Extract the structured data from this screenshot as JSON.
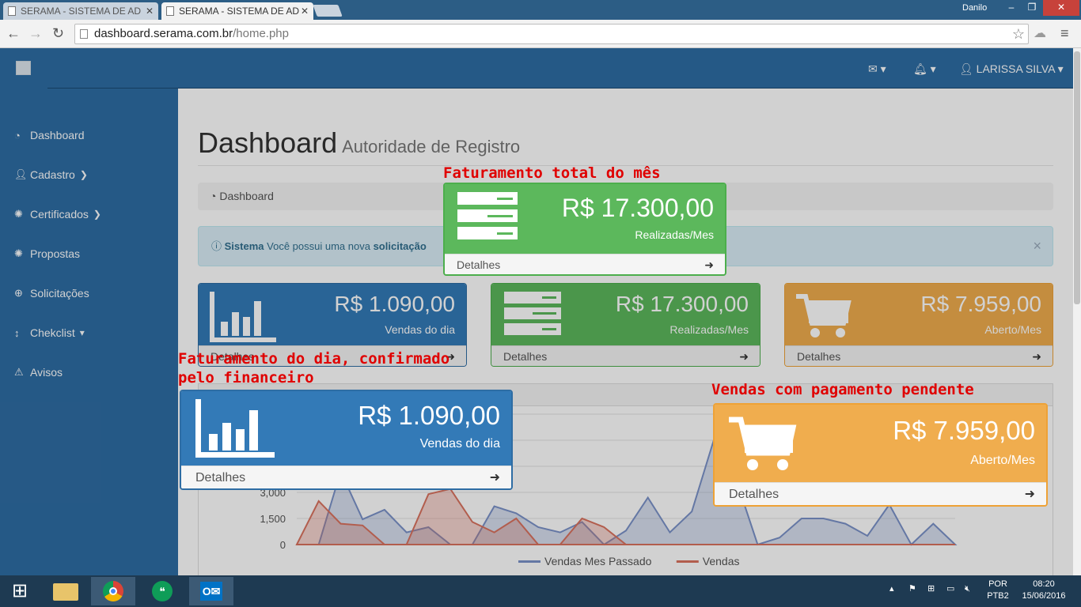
{
  "browser": {
    "tabs": [
      {
        "title": "SERAMA - SISTEMA DE AD",
        "active": false
      },
      {
        "title": "SERAMA - SISTEMA DE AD",
        "active": true
      }
    ],
    "window_user": "Danilo",
    "url_host": "dashboard.serama.com.br",
    "url_path": "/home.php"
  },
  "topnav": {
    "user_name": "LARISSA SILVA"
  },
  "sidebar": {
    "items": [
      {
        "label": "Dashboard",
        "icon": "dashboard-icon"
      },
      {
        "label": "Cadastro",
        "icon": "user-plus-icon",
        "has_caret": true
      },
      {
        "label": "Certificados",
        "icon": "gear-icon",
        "has_caret": true
      },
      {
        "label": "Propostas",
        "icon": "gear-icon"
      },
      {
        "label": "Solicitações",
        "icon": "lifebuoy-icon"
      },
      {
        "label": "Chekclist",
        "icon": "vertical-arrows-icon",
        "has_caret": true
      },
      {
        "label": "Avisos",
        "icon": "warning-icon"
      }
    ]
  },
  "page": {
    "title": "Dashboard",
    "subtitle": "Autoridade de Registro",
    "breadcrumb": "Dashboard",
    "alert": {
      "bold_lead": "Sistema",
      "text": "Você possui uma nova",
      "bold_tail": "solicitação"
    }
  },
  "panels": {
    "vendas_dia": {
      "amount": "R$ 1.090,00",
      "label": "Vendas do dia",
      "footer": "Detalhes",
      "icon": "bar-chart-icon",
      "color": "#337ab7"
    },
    "realizadas": {
      "amount": "R$ 17.300,00",
      "label": "Realizadas/Mes",
      "footer": "Detalhes",
      "icon": "server-icon",
      "color": "#5cb85c"
    },
    "aberto": {
      "amount": "R$ 7.959,00",
      "label": "Aberto/Mes",
      "footer": "Detalhes",
      "icon": "shopping-cart-icon",
      "color": "#f0ad4e"
    }
  },
  "annotations": {
    "total_mes": "Faturamento total do mês",
    "dia_line1": "Faturamento do dia, confirmado",
    "dia_line2": "pelo financeiro",
    "pendente": "Vendas com pagamento pendente"
  },
  "chart_data": {
    "type": "area",
    "title": "",
    "y_ticks": [
      "0",
      "1,500",
      "3,000"
    ],
    "ylim": [
      0,
      7500
    ],
    "series": [
      {
        "name": "Vendas Mes Passado",
        "color": "#7a92c8",
        "values": [
          0,
          0,
          4200,
          1450,
          2000,
          700,
          1000,
          0,
          0,
          2200,
          1800,
          1000,
          700,
          1300,
          0,
          800,
          2700,
          700,
          1900,
          6000,
          3800,
          0,
          400,
          1500,
          1500,
          1200,
          500,
          2300,
          0,
          1200,
          0
        ]
      },
      {
        "name": "Vendas",
        "color": "#d9725f",
        "values": [
          0,
          2500,
          1200,
          1100,
          0,
          0,
          2900,
          3200,
          1300,
          700,
          1500,
          0,
          0,
          1500,
          1000,
          0,
          0,
          0,
          0,
          0,
          0,
          0,
          0,
          0,
          0,
          0,
          0,
          0,
          0,
          0,
          0
        ]
      }
    ],
    "grid": true,
    "legend_position": "bottom"
  },
  "taskbar": {
    "lang_top": "POR",
    "lang_bottom": "PTB2",
    "time": "08:20",
    "date": "15/06/2016"
  }
}
